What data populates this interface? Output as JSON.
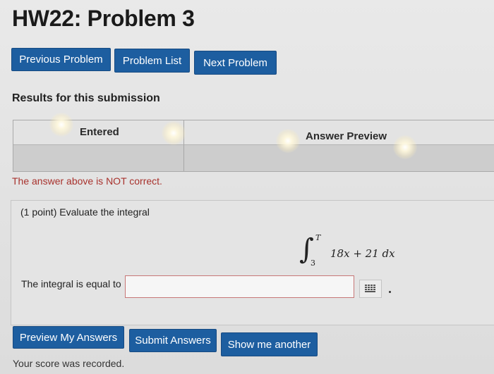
{
  "page": {
    "title": "HW22: Problem 3"
  },
  "nav": {
    "previous_label": "Previous Problem",
    "list_label": "Problem List",
    "next_label": "Next Problem"
  },
  "results": {
    "heading": "Results for this submission",
    "columns": [
      "Entered",
      "Answer Preview"
    ],
    "row": [
      "",
      ""
    ],
    "status_message": "The answer above is NOT correct."
  },
  "problem": {
    "prompt": "(1 point) Evaluate the integral",
    "integral": {
      "upper_limit": "T",
      "lower_limit": "3",
      "integrand": "18x + 21 dx"
    },
    "answer_label": "The integral is equal to",
    "answer_value": "",
    "palette_icon": "equation-palette-icon"
  },
  "actions": {
    "preview_label": "Preview My Answers",
    "submit_label": "Submit Answers",
    "show_another_label": "Show me another"
  },
  "footer": {
    "score_message": "Your score was recorded."
  },
  "colors": {
    "button_bg": "#1d5ea0",
    "error_text": "#a8322d",
    "input_border_error": "#c77777"
  }
}
